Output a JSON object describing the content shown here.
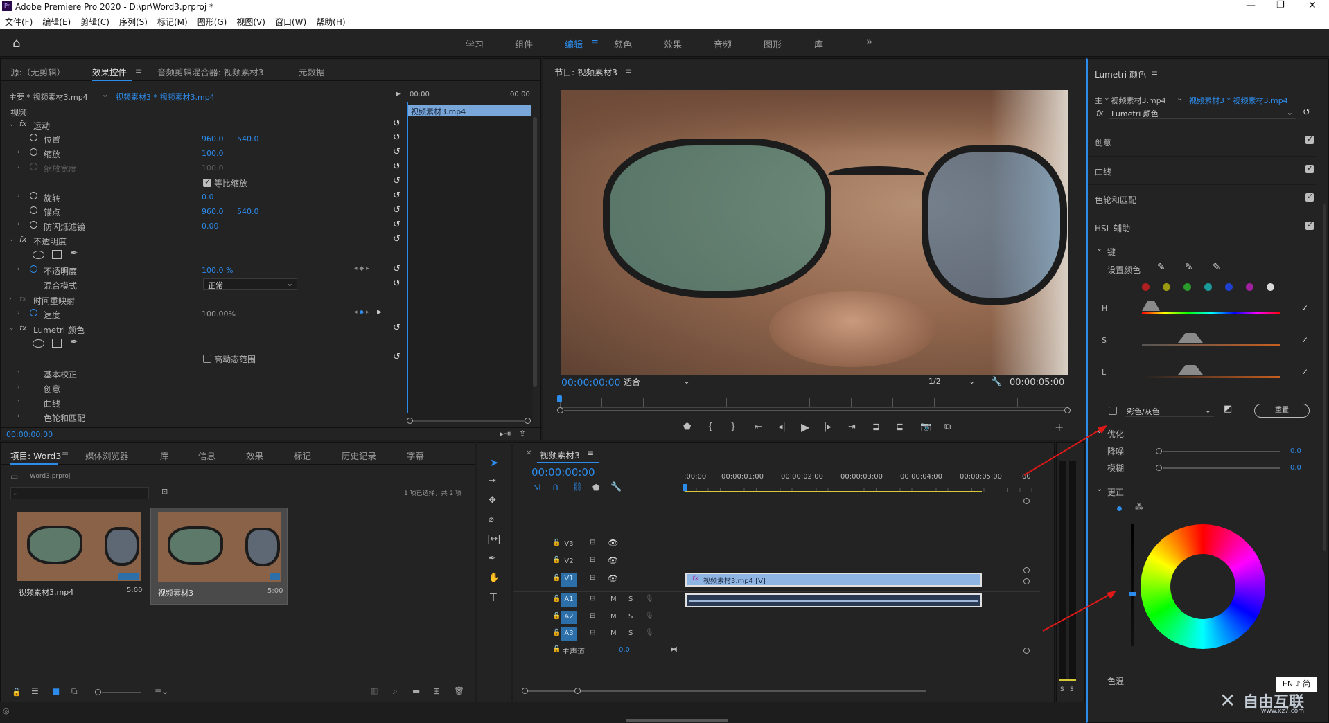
{
  "window": {
    "title": "Adobe Premiere Pro 2020 - D:\\pr\\Word3.prproj *",
    "app_icon": "Pr"
  },
  "menu": [
    "文件(F)",
    "编辑(E)",
    "剪辑(C)",
    "序列(S)",
    "标记(M)",
    "图形(G)",
    "视图(V)",
    "窗口(W)",
    "帮助(H)"
  ],
  "workspaces": {
    "items": [
      "学习",
      "组件",
      "编辑",
      "颜色",
      "效果",
      "音频",
      "图形",
      "库"
    ],
    "active": "编辑",
    "more": "»"
  },
  "effect_controls": {
    "tabs": [
      "源:（无剪辑）",
      "效果控件",
      "音频剪辑混合器: 视频素材3",
      "元数据"
    ],
    "active_tab": "效果控件",
    "master": "主要 * 视频素材3.mp4",
    "clip": "视频素材3 * 视频素材3.mp4",
    "ruler": [
      "00:00",
      "00:00"
    ],
    "clip_bar": "视频素材3.mp4",
    "section": "视频",
    "rows": [
      {
        "label": "运动",
        "fx": true
      },
      {
        "label": "位置",
        "v1": "960.0",
        "v2": "540.0"
      },
      {
        "label": "缩放",
        "v1": "100.0"
      },
      {
        "label": "缩放宽度",
        "v1": "100.0",
        "disabled": true
      },
      {
        "label": "等比缩放",
        "checkbox": true
      },
      {
        "label": "旋转",
        "v1": "0.0"
      },
      {
        "label": "锚点",
        "v1": "960.0",
        "v2": "540.0"
      },
      {
        "label": "防闪烁滤镜",
        "v1": "0.00"
      },
      {
        "label": "不透明度",
        "fx": true
      },
      {
        "label": "不透明度",
        "v1": "100.0 %"
      },
      {
        "label": "混合模式",
        "select": "正常"
      },
      {
        "label": "时间重映射"
      },
      {
        "label": "速度",
        "v1": "100.00%"
      },
      {
        "label": "Lumetri 颜色",
        "fx": true
      },
      {
        "label": "高动态范围",
        "checkbox": false
      },
      {
        "label": "基本校正"
      },
      {
        "label": "创意"
      },
      {
        "label": "曲线"
      },
      {
        "label": "色轮和匹配"
      }
    ],
    "timecode": "00:00:00:00"
  },
  "program": {
    "title": "节目: 视频素材3",
    "timecode": "00:00:00:00",
    "fit": "适合",
    "quality": "1/2",
    "duration": "00:00:05:00"
  },
  "project": {
    "tabs": [
      "项目: Word3",
      "媒体浏览器",
      "库",
      "信息",
      "效果",
      "标记",
      "历史记录",
      "字幕"
    ],
    "file": "Word3.prproj",
    "selection": "1 项已选择，共 2 项",
    "items": [
      {
        "name": "视频素材3.mp4",
        "duration": "5:00"
      },
      {
        "name": "视频素材3",
        "duration": "5:00"
      }
    ]
  },
  "timeline": {
    "tab": "视频素材3",
    "timecode": "00:00:00:00",
    "ruler": [
      ":00:00",
      "00:00:01:00",
      "00:00:02:00",
      "00:00:03:00",
      "00:00:04:00",
      "00:00:05:00",
      "00"
    ],
    "video_tracks": [
      "V3",
      "V2",
      "V1"
    ],
    "audio_tracks": [
      "A1",
      "A2",
      "A3"
    ],
    "master": "主声道",
    "master_value": "0.0",
    "clip_label": "视频素材3.mp4 [V]",
    "meter_labels": [
      "S",
      "S"
    ]
  },
  "lumetri": {
    "title": "Lumetri 颜色",
    "master": "主 * 视频素材3.mp4",
    "clip": "视频素材3 * 视频素材3.mp4",
    "effect": "Lumetri 颜色",
    "sections": [
      "创意",
      "曲线",
      "色轮和匹配",
      "HSL 辅助"
    ],
    "key": "键",
    "set_color": "设置颜色",
    "hsl": [
      "H",
      "S",
      "L"
    ],
    "swatches": [
      "#b02020",
      "#9a9a10",
      "#2a9a2a",
      "#1a9a9a",
      "#2040d0",
      "#a020a0",
      "#d8d8d8"
    ],
    "mode": "彩色/灰色",
    "reset": "重置",
    "refine": "优化",
    "denoise": "降噪",
    "denoise_value": "0.0",
    "blur": "模糊",
    "blur_value": "0.0",
    "correction": "更正",
    "temp": "色温"
  },
  "watermark": {
    "text": "自由互联",
    "url": "www.xz7.com"
  },
  "ime": "EN ♪ 简"
}
